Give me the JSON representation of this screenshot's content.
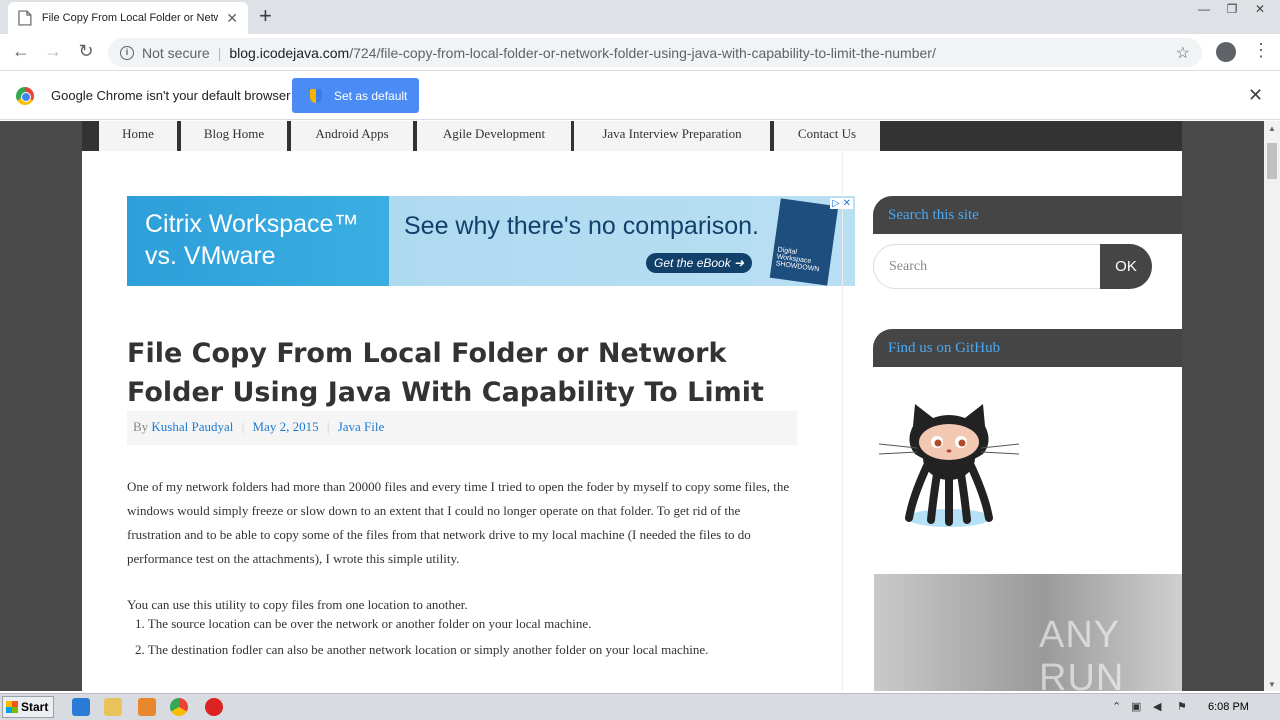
{
  "browser": {
    "tab_title": "File Copy From Local Folder or Network Folder",
    "close_tab": "✕",
    "new_tab": "+",
    "window_controls": [
      "—",
      "❐",
      "✕"
    ],
    "address": {
      "security": "Not secure",
      "domain": "blog.icodejava.com",
      "path": "/724/file-copy-from-local-folder-or-network-folder-using-java-with-capability-to-limit-the-number/"
    },
    "infobar": {
      "message": "Google Chrome isn't your default browser",
      "button": "Set as default",
      "close": "✕"
    }
  },
  "site": {
    "nav": [
      "Home",
      "Blog Home",
      "Android Apps",
      "Agile Development",
      "Java Interview Preparation",
      "Contact Us"
    ],
    "ad": {
      "brand_line1": "Citrix Workspace™",
      "brand_line2": "vs. VMware",
      "tagline": "See why there's no comparison.",
      "cta": "Get the eBook ➜",
      "book": "Digital Workspace SHOWDOWN",
      "marker": "▷ ✕"
    },
    "post": {
      "title": "File Copy From Local Folder or Network Folder Using Java With Capability To Limit The Number",
      "by": "By",
      "author": "Kushal Paudyal",
      "date": "May 2, 2015",
      "category": "Java File",
      "separator": "|",
      "para1": "One of my network folders had more than 20000 files and every time I tried to open the foder by myself to copy some files, the windows would simply freeze or slow down to an extent that I could no longer operate on that folder. To get rid of the frustration and to be able to copy some of the files from that network drive to my local machine (I needed the files to do performance test on the attachments), I wrote this simple utility.",
      "para2": "You can use this utility to copy files from one location to another.",
      "list": [
        "1.  The source location can be over the network or another folder on your local machine.",
        "2.  The destination fodler can also be another network location or simply another folder on your local machine."
      ]
    },
    "sidebar": {
      "search_title": "Search this site",
      "search_placeholder": "Search",
      "search_button": "OK",
      "github_title": "Find us on GitHub",
      "watermark": "ANY RUN"
    }
  },
  "taskbar": {
    "start": "Start",
    "clock": "6:08 PM"
  }
}
